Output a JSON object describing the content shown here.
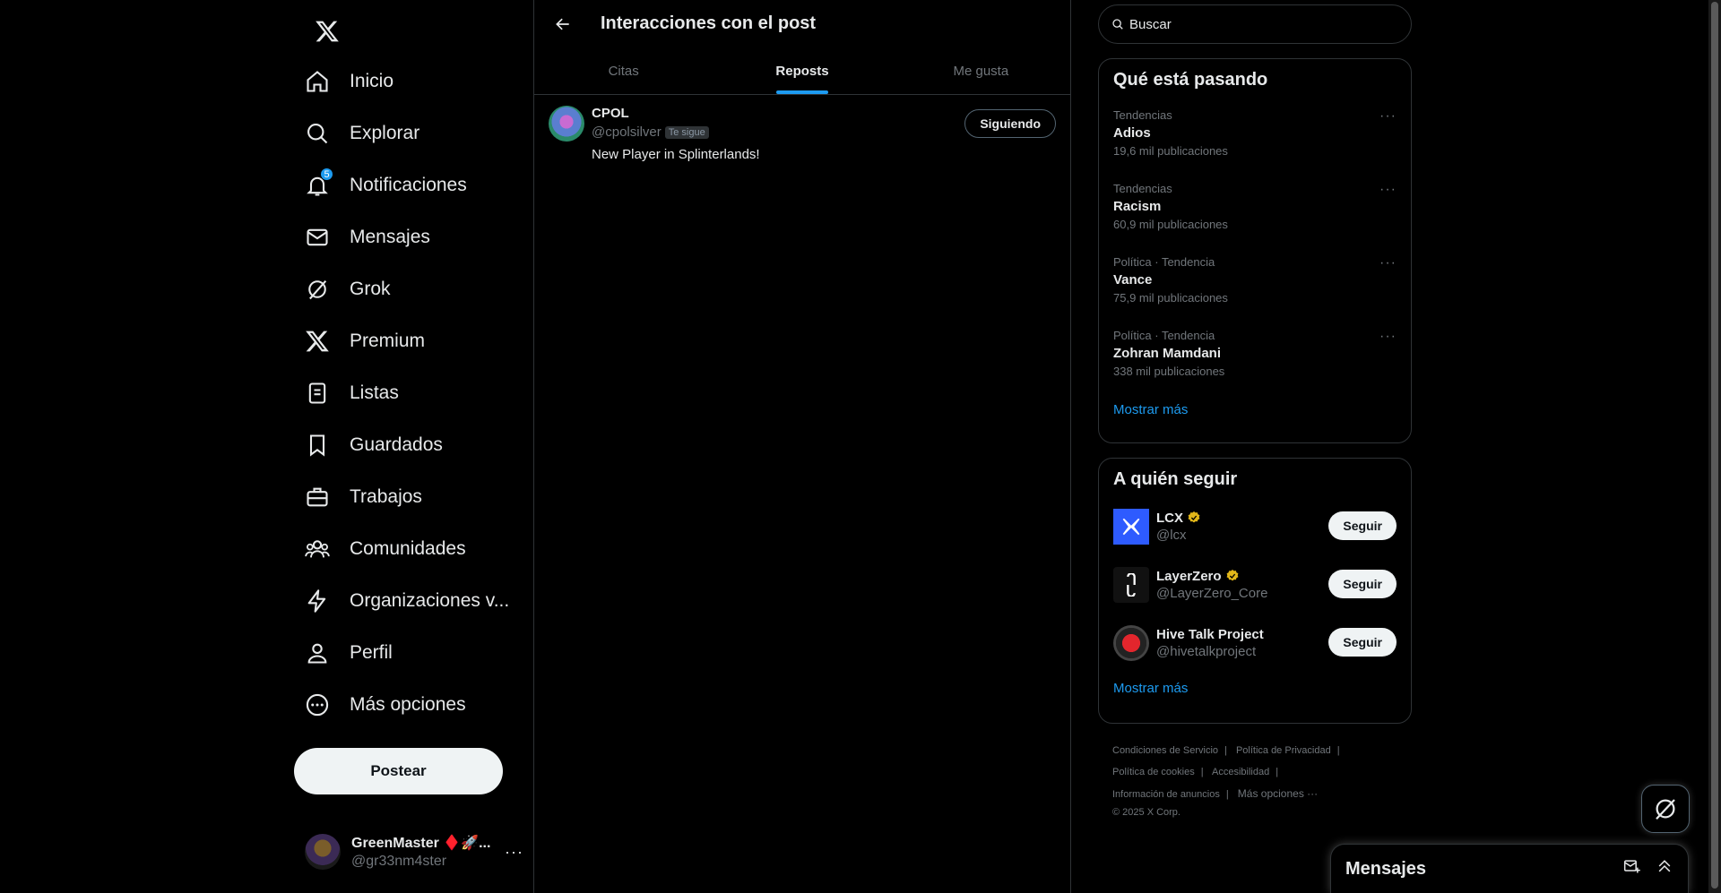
{
  "sidebar": {
    "nav": [
      {
        "label": "Inicio",
        "icon": "home-icon"
      },
      {
        "label": "Explorar",
        "icon": "search-icon"
      },
      {
        "label": "Notificaciones",
        "icon": "bell-icon",
        "badge": "5"
      },
      {
        "label": "Mensajes",
        "icon": "envelope-icon"
      },
      {
        "label": "Grok",
        "icon": "grok-icon"
      },
      {
        "label": "Premium",
        "icon": "x-icon"
      },
      {
        "label": "Listas",
        "icon": "list-icon"
      },
      {
        "label": "Guardados",
        "icon": "bookmark-icon"
      },
      {
        "label": "Trabajos",
        "icon": "briefcase-icon"
      },
      {
        "label": "Comunidades",
        "icon": "people-icon"
      },
      {
        "label": "Organizaciones v...",
        "icon": "lightning-icon"
      },
      {
        "label": "Perfil",
        "icon": "person-icon"
      },
      {
        "label": "Más opciones",
        "icon": "more-circle-icon"
      }
    ],
    "post_label": "Postear",
    "account": {
      "name": "GreenMaster ♦️🚀...",
      "handle": "@gr33nm4ster",
      "more": "···"
    }
  },
  "main": {
    "title": "Interacciones con el post",
    "tabs": [
      {
        "label": "Citas",
        "active": false
      },
      {
        "label": "Reposts",
        "active": true
      },
      {
        "label": "Me gusta",
        "active": false
      }
    ],
    "users": [
      {
        "name": "CPOL",
        "handle": "@cpolsilver",
        "follows_you": "Te sigue",
        "bio": "New Player in Splinterlands!",
        "button": "Siguiendo"
      }
    ]
  },
  "right": {
    "search_placeholder": "Buscar",
    "trends_title": "Qué está pasando",
    "trends": [
      {
        "category": "Tendencias",
        "name": "Adios",
        "count": "19,6 mil publicaciones"
      },
      {
        "category": "Tendencias",
        "name": "Racism",
        "count": "60,9 mil publicaciones"
      },
      {
        "category": "Política · Tendencia",
        "name": "Vance",
        "count": "75,9 mil publicaciones"
      },
      {
        "category": "Política · Tendencia",
        "name": "Zohran Mamdani",
        "count": "338 mil publicaciones"
      }
    ],
    "trends_show_more": "Mostrar más",
    "follow_title": "A quién seguir",
    "follow": [
      {
        "name": "LCX",
        "handle": "@lcx",
        "verified": true,
        "button": "Seguir"
      },
      {
        "name": "LayerZero",
        "handle": "@LayerZero_Core",
        "verified": true,
        "button": "Seguir"
      },
      {
        "name": "Hive Talk Project",
        "handle": "@hivetalkproject",
        "verified": false,
        "button": "Seguir"
      }
    ],
    "follow_show_more": "Mostrar más",
    "footer": {
      "links": [
        "Condiciones de Servicio",
        "Política de Privacidad",
        "Política de cookies",
        "Accesibilidad",
        "Información de anuncios",
        "Más opciones ···"
      ],
      "copyright": "© 2025 X Corp."
    }
  },
  "messages_drawer": {
    "title": "Mensajes"
  },
  "colors": {
    "accent": "#1d9bf0",
    "background": "#000000",
    "border": "#2f3336",
    "muted": "#71767b",
    "verified": "#e2b719"
  }
}
